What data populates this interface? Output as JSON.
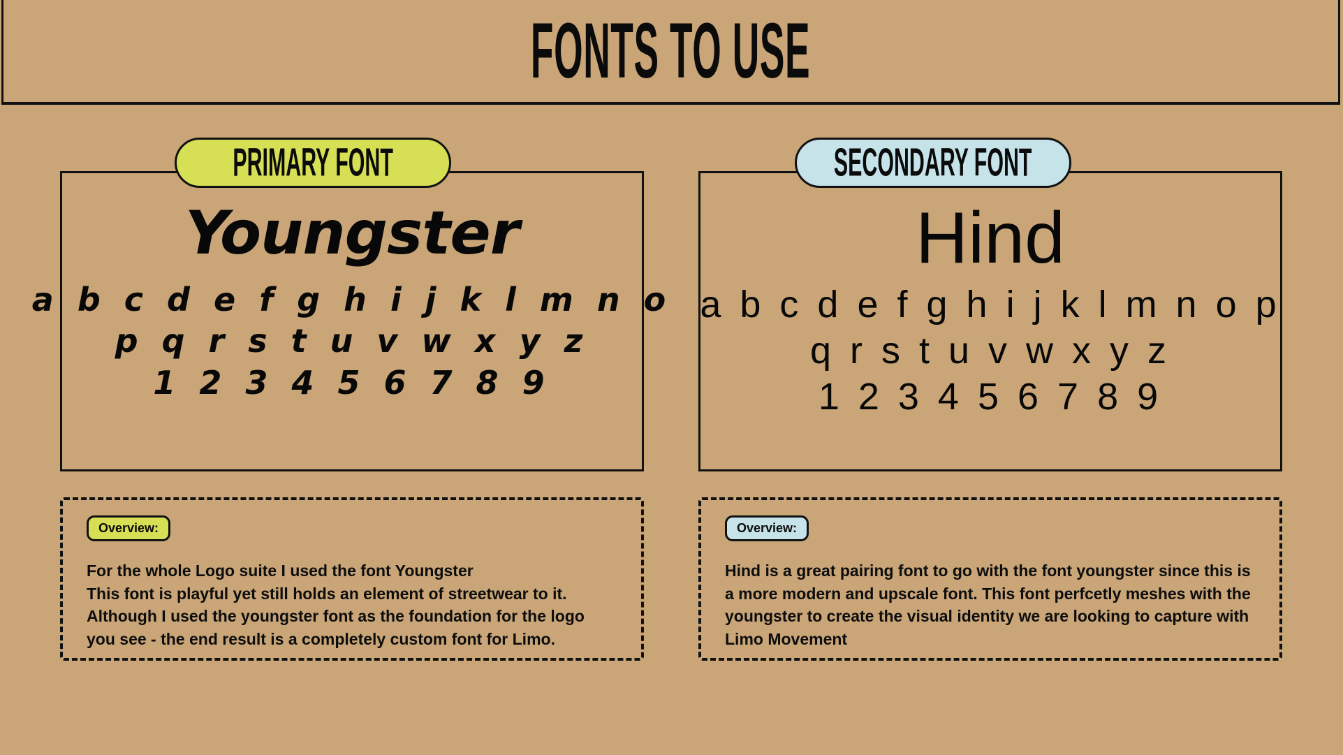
{
  "page": {
    "background_color": "#c9a578",
    "ink_color": "#111111",
    "title": "FONTS TO USE"
  },
  "columns": [
    {
      "id": "primary",
      "pill_label": "PRIMARY FONT",
      "accent_color": "#d7e055",
      "specimen": {
        "font_name": "Youngster",
        "alphabet_row_1": "a b c d e f g h i j k l m n o",
        "alphabet_row_2": "p q r s t u v w x y z",
        "numerals": "1 2 3 4 5 6 7 8 9"
      },
      "overview": {
        "badge_label": "Overview:",
        "body": "For the whole Logo suite I used the font Youngster\nThis font is playful yet still holds an element of streetwear to it. Although I used the youngster font as the foundation for the logo you see - the end result is a completely custom font for Limo."
      }
    },
    {
      "id": "secondary",
      "pill_label": "SECONDARY FONT",
      "accent_color": "#c6e3ea",
      "specimen": {
        "font_name": "Hind",
        "alphabet_row_1": "a b c d e f g h i j k l m n o p",
        "alphabet_row_2": "q r s t u v w x y z",
        "numerals": "1 2 3 4 5 6 7 8 9"
      },
      "overview": {
        "badge_label": "Overview:",
        "body": "Hind is a great pairing font to go with the font youngster since this is a more modern and upscale font. This font perfcetly meshes with the youngster to create the visual identity we are looking to capture with Limo Movement"
      }
    }
  ]
}
